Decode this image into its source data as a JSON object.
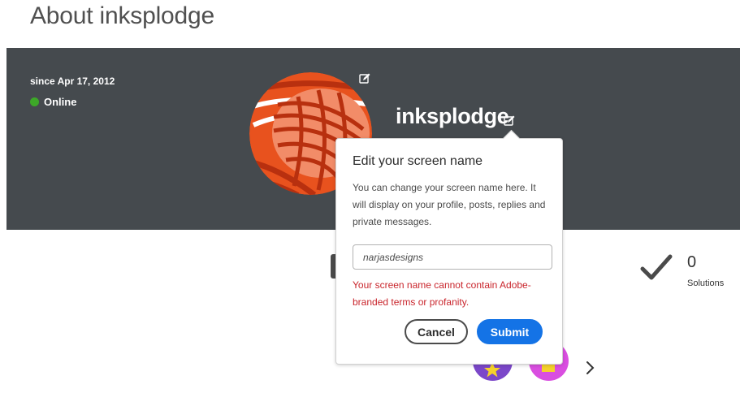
{
  "page": {
    "title": "About inksplodge"
  },
  "profile": {
    "since": "since Apr 17, 2012",
    "status": "Online",
    "screen_name": "inksplodge",
    "status_color": "#3da828"
  },
  "stats": {
    "solutions_count": "0",
    "solutions_label": "Solutions"
  },
  "edit_popover": {
    "title": "Edit your screen name",
    "description": "You can change your screen name here. It will display on your profile, posts, replies and private messages.",
    "input_value": "narjasdesigns",
    "error": "Your screen name cannot contain Adobe-branded terms or profanity.",
    "cancel_label": "Cancel",
    "submit_label": "Submit",
    "accent_color": "#1473e6",
    "error_color": "#c9252c"
  },
  "icons": {
    "avatar_edit": "edit-icon",
    "name_edit": "edit-icon",
    "solutions": "checkmark-icon",
    "next": "chevron-right-icon"
  }
}
